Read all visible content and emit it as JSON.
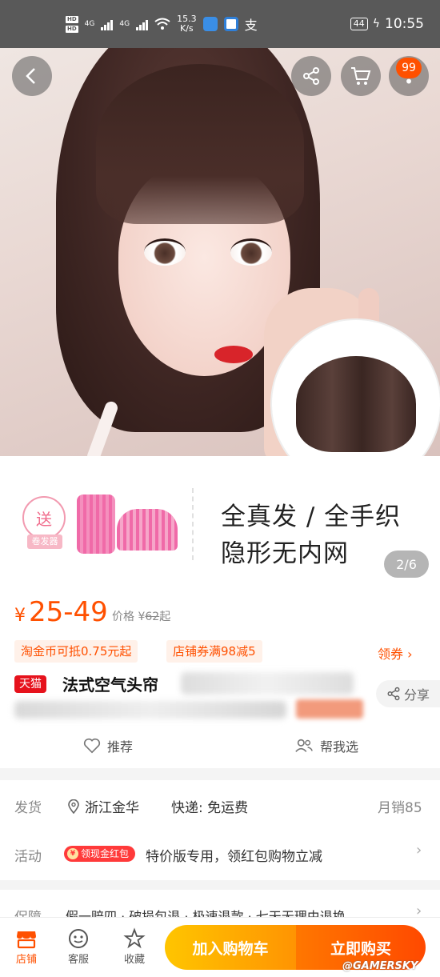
{
  "status_bar": {
    "sim1": "HD",
    "sim2": "HD",
    "net1": "4G",
    "net2": "4G",
    "speed_value": "15.3",
    "speed_unit": "K/s",
    "battery": "44",
    "time": "10:55"
  },
  "header": {
    "cart_badge": "99"
  },
  "gallery": {
    "pager": "2/6"
  },
  "promo": {
    "gift_char": "送",
    "gift_tag": "卷发器",
    "line1": "全真发 / 全手织",
    "line2": "隐形无内网"
  },
  "price": {
    "currency": "¥",
    "range": "25-49",
    "orig_label": "价格",
    "orig_currency": "¥",
    "orig_value": "62",
    "orig_suffix": "起"
  },
  "coupons": {
    "c1": "淘金币可抵0.75元起",
    "c2": "店铺券满98减5",
    "claim": "领券"
  },
  "product": {
    "store_tag": "天猫",
    "title": "法式空气头帘",
    "share": "分享",
    "recommend": "推荐",
    "help_choose": "帮我选"
  },
  "shipping": {
    "ship_label": "发货",
    "origin": "浙江金华",
    "express": "快递: 免运费",
    "sales": "月销85",
    "activity_label": "活动",
    "redpack": "领现金红包",
    "redpack_icon": "¥",
    "activity_text": "特价版专用，领红包购物立减"
  },
  "guarantee": {
    "label": "保障",
    "text": "假一赔四 · 破损包退 · 极速退款 · 七天无理由退换"
  },
  "bottom": {
    "shop": "店铺",
    "service": "客服",
    "favorite": "收藏",
    "add_cart": "加入购物车",
    "buy_now": "立即购买",
    "watermark": "@GAMERSKY"
  },
  "colors": {
    "accent": "#ff5000",
    "tmall_red": "#e6121c"
  }
}
